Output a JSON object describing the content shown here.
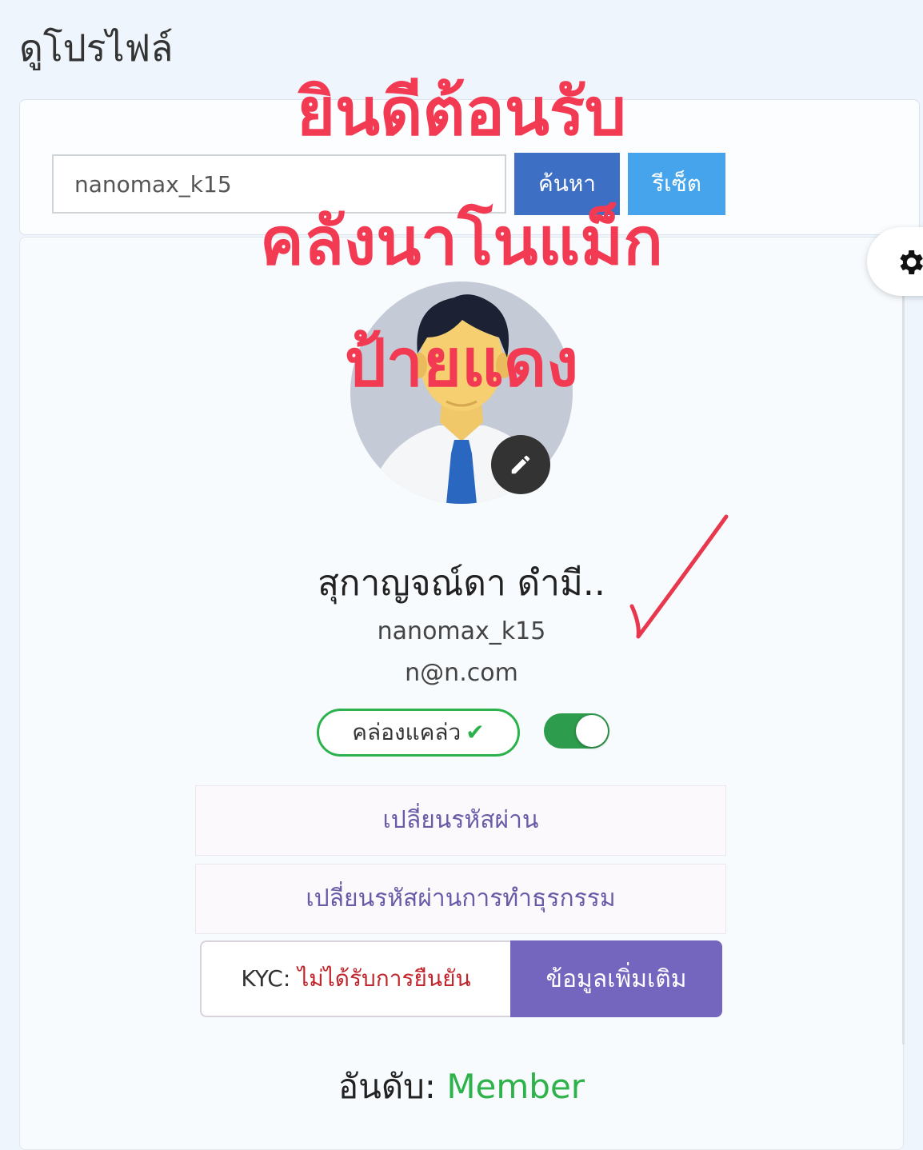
{
  "page": {
    "title": "ดูโปรไฟล์"
  },
  "search": {
    "value": "nanomax_k15",
    "search_label": "ค้นหา",
    "reset_label": "รีเซ็ต"
  },
  "overlay": {
    "line1": "ยินดีต้อนรับ",
    "line2": "คลังนาโนแม็ก",
    "line3": "ป้ายแดง",
    "color": "#f23a52"
  },
  "profile": {
    "name": "สุกาญจณ์ดา ดำมี..",
    "username": "nanomax_k15",
    "email": "n@n.com",
    "status_label": "คล่องแคล่ว",
    "status_icon": "check-icon",
    "toggle_on": true,
    "menu": [
      {
        "label": "เปลี่ยนรหัสผ่าน"
      },
      {
        "label": "เปลี่ยนรหัสผ่านการทำธุรกรรม"
      }
    ],
    "kyc_label": "KYC:",
    "kyc_status": "ไม่ได้รับการยืนยัน",
    "more_info_label": "ข้อมูลเพิ่มเติม",
    "rank_label": "อันดับ:",
    "rank_value": "Member"
  },
  "colors": {
    "search_button": "#3d6fc4",
    "reset_button": "#45a4ec",
    "accent_purple": "#7465bf",
    "status_green": "#2bb24c",
    "kyc_red": "#c0262c"
  },
  "icons": [
    "gear-icon",
    "pencil-icon",
    "check-icon",
    "checkmark-annotation-icon"
  ]
}
